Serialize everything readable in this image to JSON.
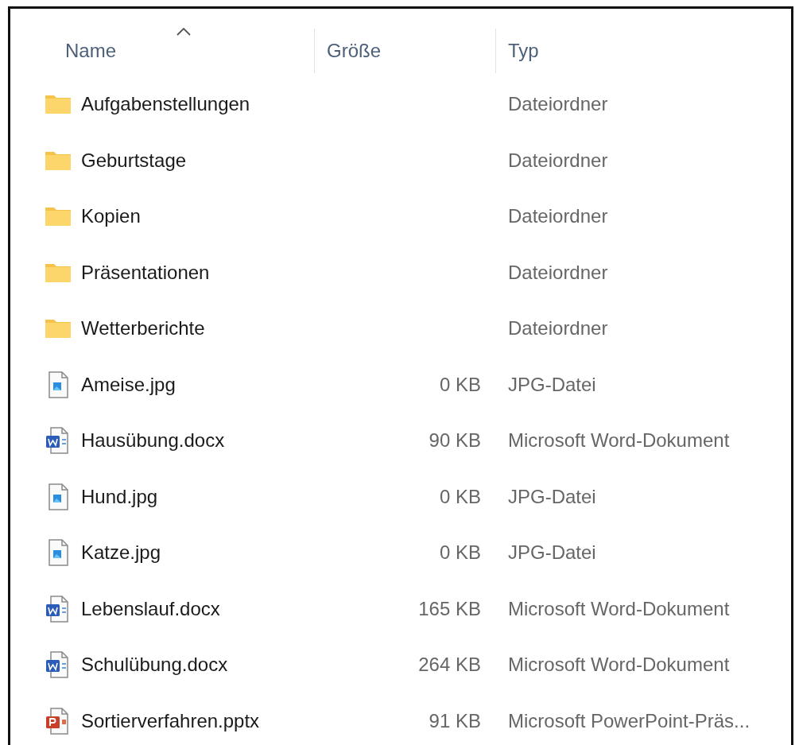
{
  "columns": [
    {
      "label": "Name",
      "sorted_ascending": true
    },
    {
      "label": "Größe"
    },
    {
      "label": "Typ"
    }
  ],
  "rows": [
    {
      "name": "Aufgabenstellungen",
      "kind": "folder",
      "type": "Dateiordner"
    },
    {
      "name": "Geburtstage",
      "kind": "folder",
      "type": "Dateiordner"
    },
    {
      "name": "Kopien",
      "kind": "folder",
      "type": "Dateiordner"
    },
    {
      "name": "Präsentationen",
      "kind": "folder",
      "type": "Dateiordner"
    },
    {
      "name": "Wetterberichte",
      "kind": "folder",
      "type": "Dateiordner"
    },
    {
      "name": "Ameise.jpg",
      "kind": "image",
      "size": "0 KB",
      "type": "JPG-Datei"
    },
    {
      "name": "Hausübung.docx",
      "kind": "word",
      "size": "90 KB",
      "type": "Microsoft Word-Dokument"
    },
    {
      "name": "Hund.jpg",
      "kind": "image",
      "size": "0 KB",
      "type": "JPG-Datei"
    },
    {
      "name": "Katze.jpg",
      "kind": "image",
      "size": "0 KB",
      "type": "JPG-Datei"
    },
    {
      "name": "Lebenslauf.docx",
      "kind": "word",
      "size": "165 KB",
      "type": "Microsoft Word-Dokument"
    },
    {
      "name": "Schulübung.docx",
      "kind": "word",
      "size": "264 KB",
      "type": "Microsoft Word-Dokument"
    },
    {
      "name": "Sortierverfahren.pptx",
      "kind": "powerpoint",
      "size": "91 KB",
      "type": "Microsoft PowerPoint-Präs..."
    }
  ]
}
